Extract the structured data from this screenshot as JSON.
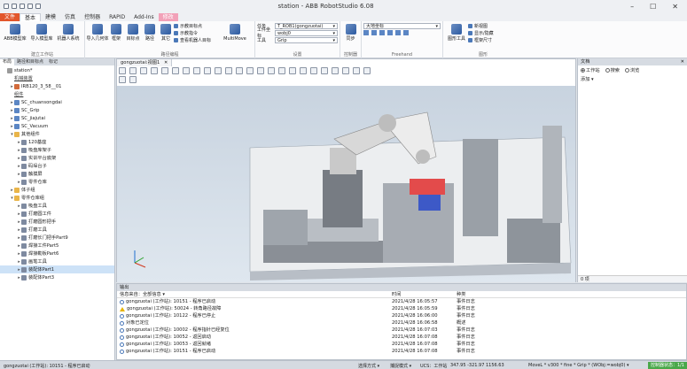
{
  "window": {
    "title": "station - ABB RobotStudio 6.08",
    "controls": [
      "–",
      "☐",
      "✕"
    ]
  },
  "ribbon_tabs": [
    {
      "label": "文件",
      "kind": "file"
    },
    {
      "label": "基本",
      "kind": "active"
    },
    {
      "label": "建模",
      "kind": ""
    },
    {
      "label": "仿真",
      "kind": ""
    },
    {
      "label": "控制器",
      "kind": ""
    },
    {
      "label": "RAPID",
      "kind": ""
    },
    {
      "label": "Add-Ins",
      "kind": ""
    },
    {
      "label": "修改",
      "kind": "ctx"
    }
  ],
  "ribbon": {
    "build_station": {
      "label": "建立工作站",
      "buttons": [
        "ABB模型库",
        "导入模型库",
        "机器人系统"
      ]
    },
    "path_programming": {
      "label": "路径编程",
      "buttons": [
        "导入几何体",
        "框架",
        "目标点",
        "路径",
        "其它"
      ],
      "teach_items": [
        "示教目标点",
        "示教指令",
        "查看机器人目标"
      ],
      "multimove": "MultiMove"
    },
    "settings": {
      "label": "设置",
      "task_label": "任务",
      "task_value": "T_ROB1(gongzuotai)",
      "wobj_label": "工件坐标",
      "wobj_value": "wobj0",
      "tool_label": "工具",
      "tool_value": "Grip"
    },
    "controller": {
      "label": "控制器",
      "button": "同步"
    },
    "freehand": {
      "label": "Freehand",
      "frame_value": "大地坐标"
    },
    "graphics": {
      "label": "图形",
      "button": "图形工具",
      "items": [
        "新视图",
        "显示/隐藏",
        "框架尺寸"
      ]
    }
  },
  "left_pane": {
    "tabs": [
      "布局",
      "路径和目标点",
      "标记"
    ],
    "tree": [
      {
        "text": "station*",
        "level": 0,
        "exp": "",
        "icon": "station"
      },
      {
        "text": "机械装置",
        "level": 1,
        "exp": "",
        "icon": "",
        "underline": true
      },
      {
        "text": "IRB120_3_58__01",
        "level": 1,
        "exp": "▸",
        "icon": "robot"
      },
      {
        "text": "组件",
        "level": 1,
        "exp": "",
        "icon": "",
        "underline": true
      },
      {
        "text": "SC_chuansongdai",
        "level": 1,
        "exp": "▸",
        "icon": "tool"
      },
      {
        "text": "SC_Grip",
        "level": 1,
        "exp": "▸",
        "icon": "tool"
      },
      {
        "text": "SC_jiajutai",
        "level": 1,
        "exp": "▸",
        "icon": "tool"
      },
      {
        "text": "SC_Vacuum",
        "level": 1,
        "exp": "▸",
        "icon": "tool"
      },
      {
        "text": "其他组件",
        "level": 1,
        "exp": "▾",
        "icon": "folder"
      },
      {
        "text": "120基座",
        "level": 2,
        "exp": "▸",
        "icon": "part"
      },
      {
        "text": "吸盘库架子",
        "level": 2,
        "exp": "▸",
        "icon": "part"
      },
      {
        "text": "实训平台底架",
        "level": 2,
        "exp": "▸",
        "icon": "part"
      },
      {
        "text": "码垛台子",
        "level": 2,
        "exp": "▸",
        "icon": "part"
      },
      {
        "text": "触摸屏",
        "level": 2,
        "exp": "▸",
        "icon": "part"
      },
      {
        "text": "零件仓库",
        "level": 2,
        "exp": "▸",
        "icon": "part"
      },
      {
        "text": "体子组",
        "level": 1,
        "exp": "▸",
        "icon": "folder"
      },
      {
        "text": "零件仓库组",
        "level": 1,
        "exp": "▾",
        "icon": "folder"
      },
      {
        "text": "吸盘工具",
        "level": 2,
        "exp": "▸",
        "icon": "part"
      },
      {
        "text": "打磨圆工件",
        "level": 2,
        "exp": "▸",
        "icon": "part"
      },
      {
        "text": "打磨圆形把手",
        "level": 2,
        "exp": "▸",
        "icon": "part"
      },
      {
        "text": "打磨工具",
        "level": 2,
        "exp": "▸",
        "icon": "part"
      },
      {
        "text": "打磨长门把手Part9",
        "level": 2,
        "exp": "▸",
        "icon": "part"
      },
      {
        "text": "焊接工件Part5",
        "level": 2,
        "exp": "▸",
        "icon": "part"
      },
      {
        "text": "焊接勒板Part6",
        "level": 2,
        "exp": "▸",
        "icon": "part"
      },
      {
        "text": "画笔工具",
        "level": 2,
        "exp": "▸",
        "icon": "part"
      },
      {
        "text": "装配体Part1",
        "level": 2,
        "exp": "▸",
        "icon": "part",
        "selected": true
      },
      {
        "text": "装配体Part3",
        "level": 2,
        "exp": "▸",
        "icon": "part"
      }
    ]
  },
  "viewport": {
    "tab": "gongzuotai:视图1",
    "close": "✕"
  },
  "right_pane": {
    "title": "文档",
    "radios": [
      {
        "label": "工作站",
        "on": true
      },
      {
        "label": "搜索",
        "on": false
      },
      {
        "label": "浏览",
        "on": false
      }
    ],
    "add_label": "添加 ▾",
    "footer": "0 项"
  },
  "output": {
    "title": "输出",
    "filter_label": "信息来自：全部信息",
    "col_time": "时间",
    "col_category": "种类",
    "rows": [
      {
        "icon": "info",
        "msg": "gongzuotai (工作站): 10151 - 程序已启动",
        "time": "2021/4/28 16:05:57",
        "cat": "事件日志"
      },
      {
        "icon": "warn",
        "msg": "gongzuotai (工作站): 50024 - 转角路径故障",
        "time": "2021/4/28 16:05:59",
        "cat": "事件日志"
      },
      {
        "icon": "info",
        "msg": "gongzuotai (工作站): 10122 - 程序已停止",
        "time": "2021/4/28 16:06:00",
        "cat": "事件日志"
      },
      {
        "icon": "info",
        "msg": "对象已定位",
        "time": "2021/4/28 16:06:58",
        "cat": "概述"
      },
      {
        "icon": "info",
        "msg": "gongzuotai (工作站): 10002 - 程序指针已经复位",
        "time": "2021/4/28 16:07:03",
        "cat": "事件日志"
      },
      {
        "icon": "info",
        "msg": "gongzuotai (工作站): 10052 - 返回启动",
        "time": "2021/4/28 16:07:08",
        "cat": "事件日志"
      },
      {
        "icon": "info",
        "msg": "gongzuotai (工作站): 10053 - 返回就绪",
        "time": "2021/4/28 16:07:08",
        "cat": "事件日志"
      },
      {
        "icon": "info",
        "msg": "gongzuotai (工作站): 10151 - 程序已启动",
        "time": "2021/4/28 16:07:08",
        "cat": "事件日志"
      }
    ]
  },
  "status": {
    "left": "gongzuotai (工作站): 10151 - 程序已启动",
    "select_mode": "选择方式 ▾",
    "snap_mode": "捕捉模式 ▾",
    "ucs": "UCS：工作站",
    "coords": "347.95   -321.97   1156.63",
    "move_settings": "MoveL * v300 * fine * Grip * (WObj:=wobj0) ▾",
    "controller_status": "控制器状态：1/1"
  }
}
